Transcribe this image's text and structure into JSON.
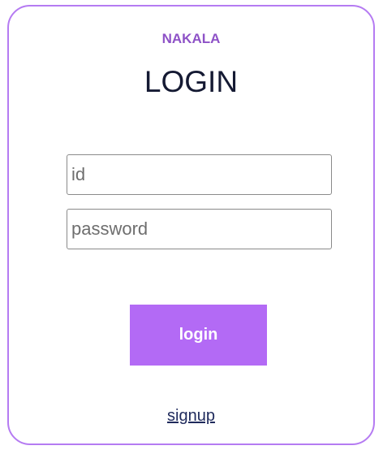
{
  "card": {
    "brand": "NAKALA",
    "title": "LOGIN"
  },
  "form": {
    "id_placeholder": "id",
    "id_value": "",
    "password_placeholder": "password",
    "password_value": "",
    "login_label": "login",
    "signup_label": "signup"
  },
  "colors": {
    "accent": "#b36af5",
    "border": "#b57bf2",
    "brand_text": "#8e52c7",
    "title_text": "#151a33"
  }
}
